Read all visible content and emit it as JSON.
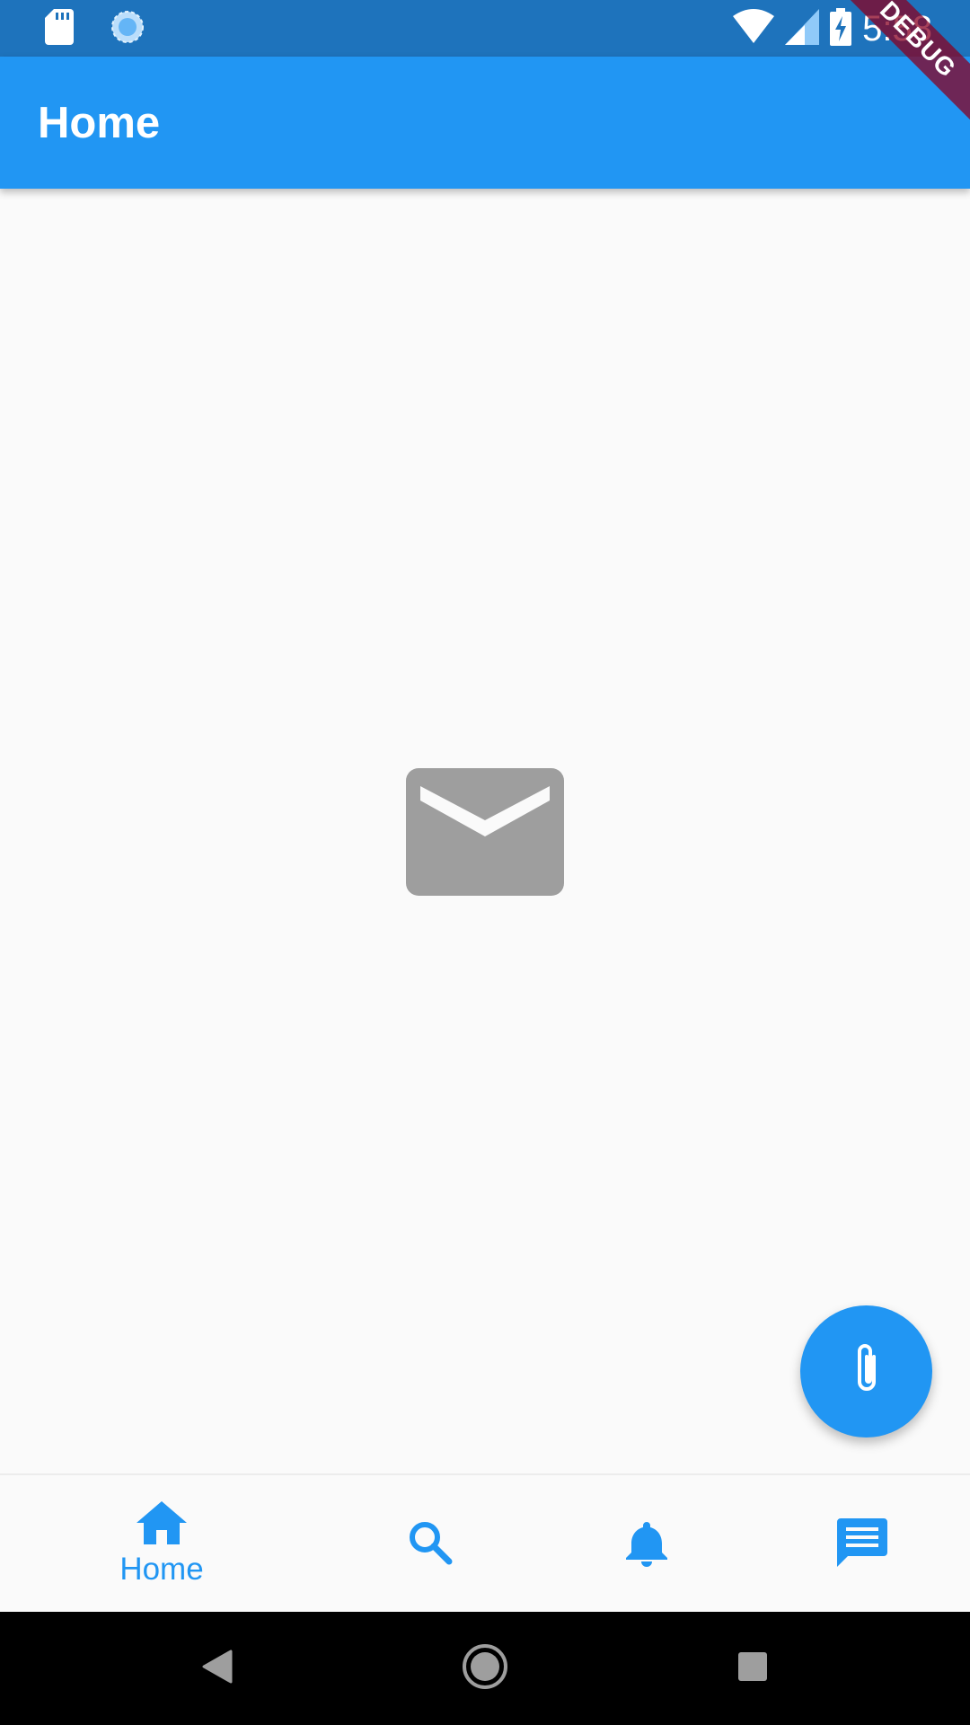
{
  "status_bar": {
    "time": "5:58",
    "icons": [
      "sd-card-icon",
      "sync-icon",
      "wifi-icon",
      "signal-icon",
      "battery-charging-icon"
    ]
  },
  "app_bar": {
    "title": "Home"
  },
  "debug_banner": {
    "label": "DEBUG"
  },
  "content": {
    "center_icon": "mail-icon"
  },
  "fab": {
    "icon": "attach-icon"
  },
  "bottom_nav": {
    "selected_index": 0,
    "items": [
      {
        "icon": "home-icon",
        "label": "Home"
      },
      {
        "icon": "search-icon",
        "label": ""
      },
      {
        "icon": "notifications-icon",
        "label": ""
      },
      {
        "icon": "chat-icon",
        "label": ""
      }
    ]
  },
  "system_nav": {
    "buttons": [
      "back-icon",
      "home-circle-icon",
      "recents-icon"
    ]
  },
  "colors": {
    "status_bar": "#1e73bc",
    "primary": "#2196f3",
    "background": "#fafafa",
    "icon_grey": "#9e9e9e",
    "debug_banner": "#880022"
  }
}
